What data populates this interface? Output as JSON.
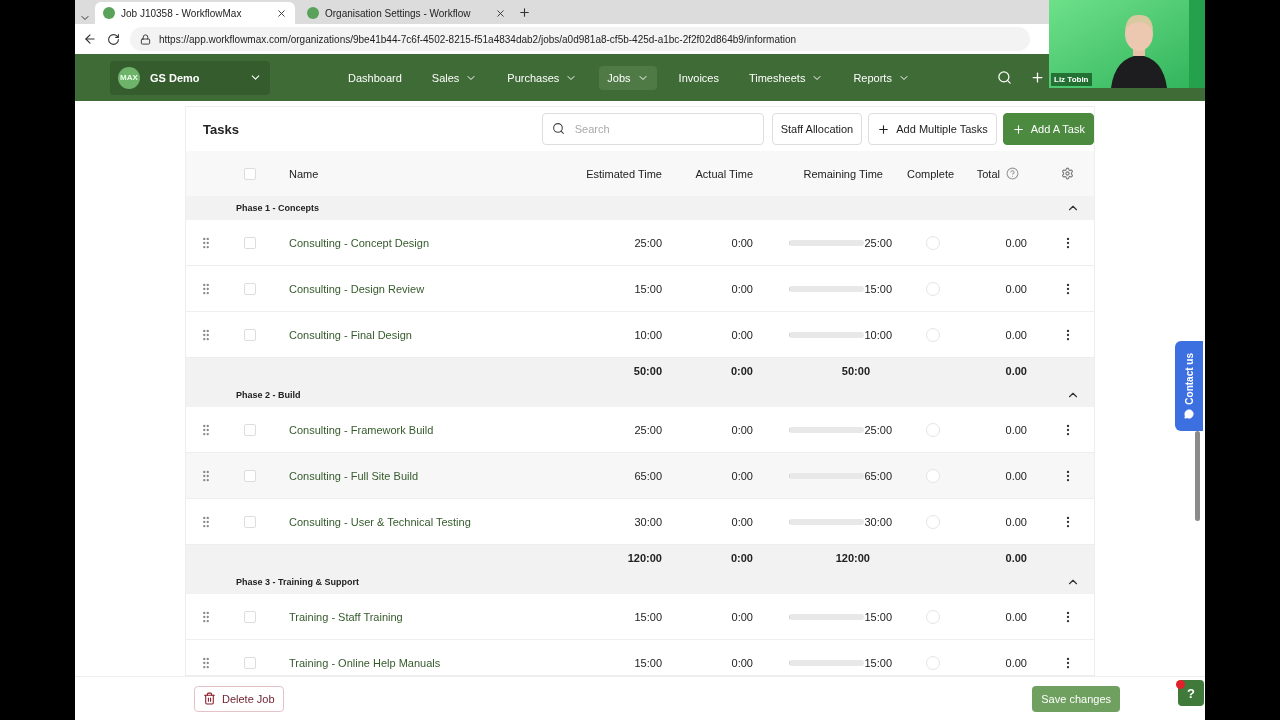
{
  "browser": {
    "tabs": [
      {
        "title": "Job J10358 - WorkflowMax",
        "selected": true
      },
      {
        "title": "Organisation Settings - Workflow",
        "selected": false
      }
    ],
    "url": "https://app.workflowmax.com/organizations/9be41b44-7c6f-4502-8215-f51a4834dab2/jobs/a0d981a8-cf5b-425d-a1bc-2f2f02d864b9/information"
  },
  "nav": {
    "org": "GS Demo",
    "org_badge": "MAX",
    "items": [
      {
        "label": "Dashboard",
        "dropdown": false,
        "selected": false
      },
      {
        "label": "Sales",
        "dropdown": true,
        "selected": false
      },
      {
        "label": "Purchases",
        "dropdown": true,
        "selected": false
      },
      {
        "label": "Jobs",
        "dropdown": true,
        "selected": true
      },
      {
        "label": "Invoices",
        "dropdown": false,
        "selected": false
      },
      {
        "label": "Timesheets",
        "dropdown": true,
        "selected": false
      },
      {
        "label": "Reports",
        "dropdown": true,
        "selected": false
      }
    ]
  },
  "tasks": {
    "title": "Tasks",
    "search": {
      "placeholder": "Search"
    },
    "staff_button": "Staff Allocation",
    "multi_button": "Add Multiple Tasks",
    "add_button": "Add A Task",
    "select_all": false,
    "columns": [
      "Name",
      "Estimated Time",
      "Actual Time",
      "Remaining Time",
      "Complete",
      "Total"
    ],
    "phases": [
      {
        "name": "Phase 1 - Concepts",
        "expanded": true,
        "rows": [
          {
            "name": "Consulting - Concept Design",
            "estimated": "25:00",
            "actual": "0:00",
            "level": 0,
            "remaining": "25:00",
            "complete": false,
            "total": "0.00",
            "selected": false,
            "highlighted": false
          },
          {
            "name": "Consulting - Design Review",
            "estimated": "15:00",
            "actual": "0:00",
            "level": 0,
            "remaining": "15:00",
            "complete": false,
            "total": "0.00",
            "selected": false,
            "highlighted": false
          },
          {
            "name": "Consulting - Final Design",
            "estimated": "10:00",
            "actual": "0:00",
            "level": 0,
            "remaining": "10:00",
            "complete": false,
            "total": "0.00",
            "selected": false,
            "highlighted": false
          }
        ],
        "totals": {
          "estimated": "50:00",
          "actual": "0:00",
          "remaining": "50:00",
          "total": "0.00"
        }
      },
      {
        "name": "Phase 2 - Build",
        "expanded": true,
        "rows": [
          {
            "name": "Consulting - Framework Build",
            "estimated": "25:00",
            "actual": "0:00",
            "level": 0,
            "remaining": "25:00",
            "complete": false,
            "total": "0.00",
            "selected": false,
            "highlighted": false
          },
          {
            "name": "Consulting - Full Site Build",
            "estimated": "65:00",
            "actual": "0:00",
            "level": 0,
            "remaining": "65:00",
            "complete": false,
            "total": "0.00",
            "selected": false,
            "highlighted": true
          },
          {
            "name": "Consulting - User & Technical Testing",
            "estimated": "30:00",
            "actual": "0:00",
            "level": 0,
            "remaining": "30:00",
            "complete": false,
            "total": "0.00",
            "selected": false,
            "highlighted": false
          }
        ],
        "totals": {
          "estimated": "120:00",
          "actual": "0:00",
          "remaining": "120:00",
          "total": "0.00"
        }
      },
      {
        "name": "Phase 3 - Training & Support",
        "expanded": true,
        "rows": [
          {
            "name": "Training - Staff Training",
            "estimated": "15:00",
            "actual": "0:00",
            "level": 0,
            "remaining": "15:00",
            "complete": false,
            "total": "0.00",
            "selected": false,
            "highlighted": false
          },
          {
            "name": "Training - Online Help Manuals",
            "estimated": "15:00",
            "actual": "0:00",
            "level": 0,
            "remaining": "15:00",
            "complete": false,
            "total": "0.00",
            "selected": false,
            "highlighted": false
          }
        ]
      }
    ]
  },
  "footer": {
    "delete_button": "Delete Job",
    "save_button": "Save changes"
  },
  "contact_tab": "Contact us",
  "help_button": "?",
  "help_notification": true,
  "video": {
    "kind": "picture",
    "name": "Liz Tobin"
  }
}
